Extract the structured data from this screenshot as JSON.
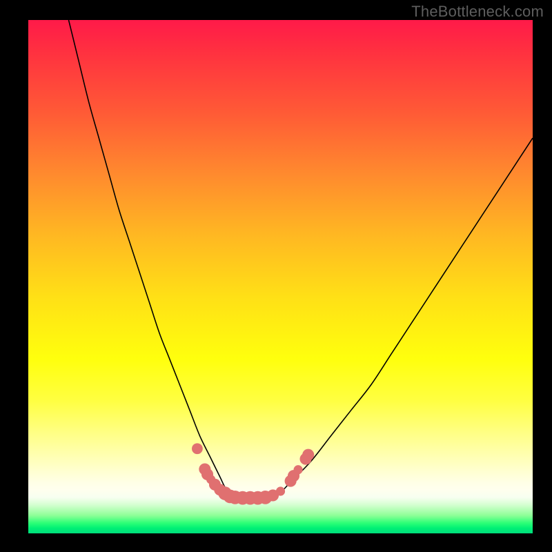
{
  "watermark": "TheBottleneck.com",
  "chart_data": {
    "type": "line",
    "title": "",
    "xlabel": "",
    "ylabel": "",
    "xlim": [
      0,
      100
    ],
    "ylim": [
      0,
      100
    ],
    "series": [
      {
        "name": "bottleneck-curve",
        "x": [
          8,
          10,
          12,
          14,
          16,
          18,
          20,
          22,
          24,
          26,
          28,
          30,
          32,
          34,
          36,
          38,
          39,
          40,
          41,
          42,
          44,
          46,
          48,
          50,
          52,
          56,
          60,
          64,
          68,
          72,
          76,
          80,
          84,
          88,
          92,
          96,
          100
        ],
        "y": [
          100,
          92,
          84,
          77,
          70,
          63,
          57,
          51,
          45,
          39,
          34,
          29,
          24,
          19,
          15,
          11,
          9,
          8,
          7.2,
          7,
          7,
          7,
          7.2,
          8,
          10,
          14,
          19,
          24,
          29,
          35,
          41,
          47,
          53,
          59,
          65,
          71,
          77
        ]
      }
    ],
    "markers": [
      {
        "x": 33.5,
        "y": 16.5,
        "r": 1.2
      },
      {
        "x": 35,
        "y": 12.5,
        "r": 1.3
      },
      {
        "x": 35.5,
        "y": 11.5,
        "r": 1.3
      },
      {
        "x": 36.2,
        "y": 10.5,
        "r": 1.0
      },
      {
        "x": 37,
        "y": 9.5,
        "r": 1.3
      },
      {
        "x": 38,
        "y": 8.5,
        "r": 1.3
      },
      {
        "x": 39,
        "y": 7.8,
        "r": 1.5
      },
      {
        "x": 40,
        "y": 7.2,
        "r": 1.5
      },
      {
        "x": 41,
        "y": 7.0,
        "r": 1.5
      },
      {
        "x": 42.5,
        "y": 6.9,
        "r": 1.5
      },
      {
        "x": 44,
        "y": 6.9,
        "r": 1.5
      },
      {
        "x": 45.5,
        "y": 6.9,
        "r": 1.5
      },
      {
        "x": 47,
        "y": 7.0,
        "r": 1.5
      },
      {
        "x": 48.5,
        "y": 7.4,
        "r": 1.3
      },
      {
        "x": 50,
        "y": 8.2,
        "r": 1.0
      },
      {
        "x": 52,
        "y": 10.2,
        "r": 1.3
      },
      {
        "x": 52.6,
        "y": 11.2,
        "r": 1.3
      },
      {
        "x": 53.5,
        "y": 12.4,
        "r": 1.0
      },
      {
        "x": 55,
        "y": 14.5,
        "r": 1.3
      },
      {
        "x": 55.5,
        "y": 15.3,
        "r": 1.3
      }
    ],
    "marker_color": "#e07070",
    "curve_color": "#000000"
  }
}
